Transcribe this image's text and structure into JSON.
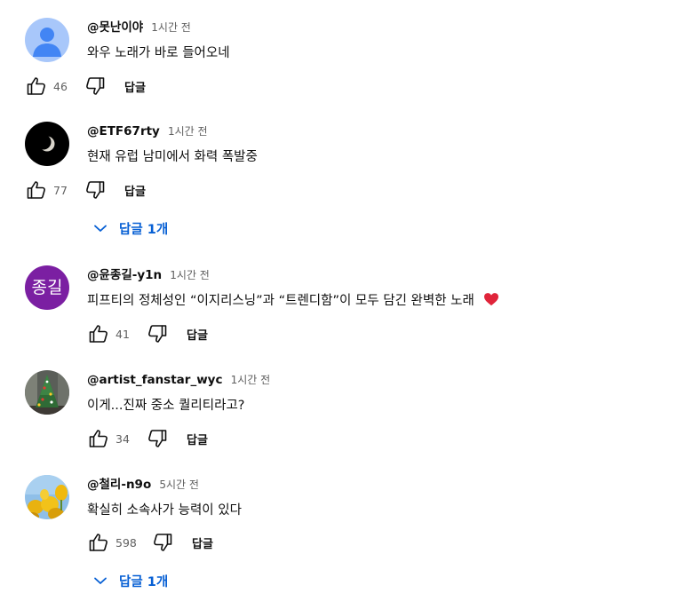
{
  "comments": [
    {
      "author": "@못난이야",
      "time": "1시간 전",
      "text": "와우  노래가  바로 들어오네",
      "likes": "46",
      "reply_label": "답글",
      "avatar": "default-person-avatar"
    },
    {
      "author": "@ETF67rty",
      "time": "1시간 전",
      "text": "현재 유럽 남미에서 화력 폭발중",
      "likes": "77",
      "reply_label": "답글",
      "replies_toggle": "답글 1개",
      "avatar": "moon-avatar"
    },
    {
      "author": "@윤종길-y1n",
      "time": "1시간 전",
      "text": "피프티의 정체성인 “이지리스닝”과 “트렌디함”이 모두 담긴 완벽한 노래",
      "likes": "41",
      "reply_label": "답글",
      "avatar": "initials-avatar",
      "avatar_initials": "종길"
    },
    {
      "author": "@artist_fanstar_wyc",
      "time": "1시간 전",
      "text": "이게...진짜 중소 퀄리티라고?",
      "likes": "34",
      "reply_label": "답글",
      "avatar": "christmas-tree-avatar"
    },
    {
      "author": "@철리-n9o",
      "time": "5시간 전",
      "text": "확실히 소속사가 능력이 있다",
      "likes": "598",
      "reply_label": "답글",
      "replies_toggle": "답글 1개",
      "avatar": "tulips-avatar"
    }
  ],
  "colors": {
    "link_blue": "#065fd4",
    "secondary_text": "#606060",
    "primary_text": "#0f0f0f",
    "heart": "#e0243a",
    "initials_avatar_bg": "#7b1fa2"
  },
  "icons": [
    "thumbs-up-icon",
    "thumbs-down-icon",
    "chevron-down-icon",
    "heart-emoji-icon"
  ]
}
